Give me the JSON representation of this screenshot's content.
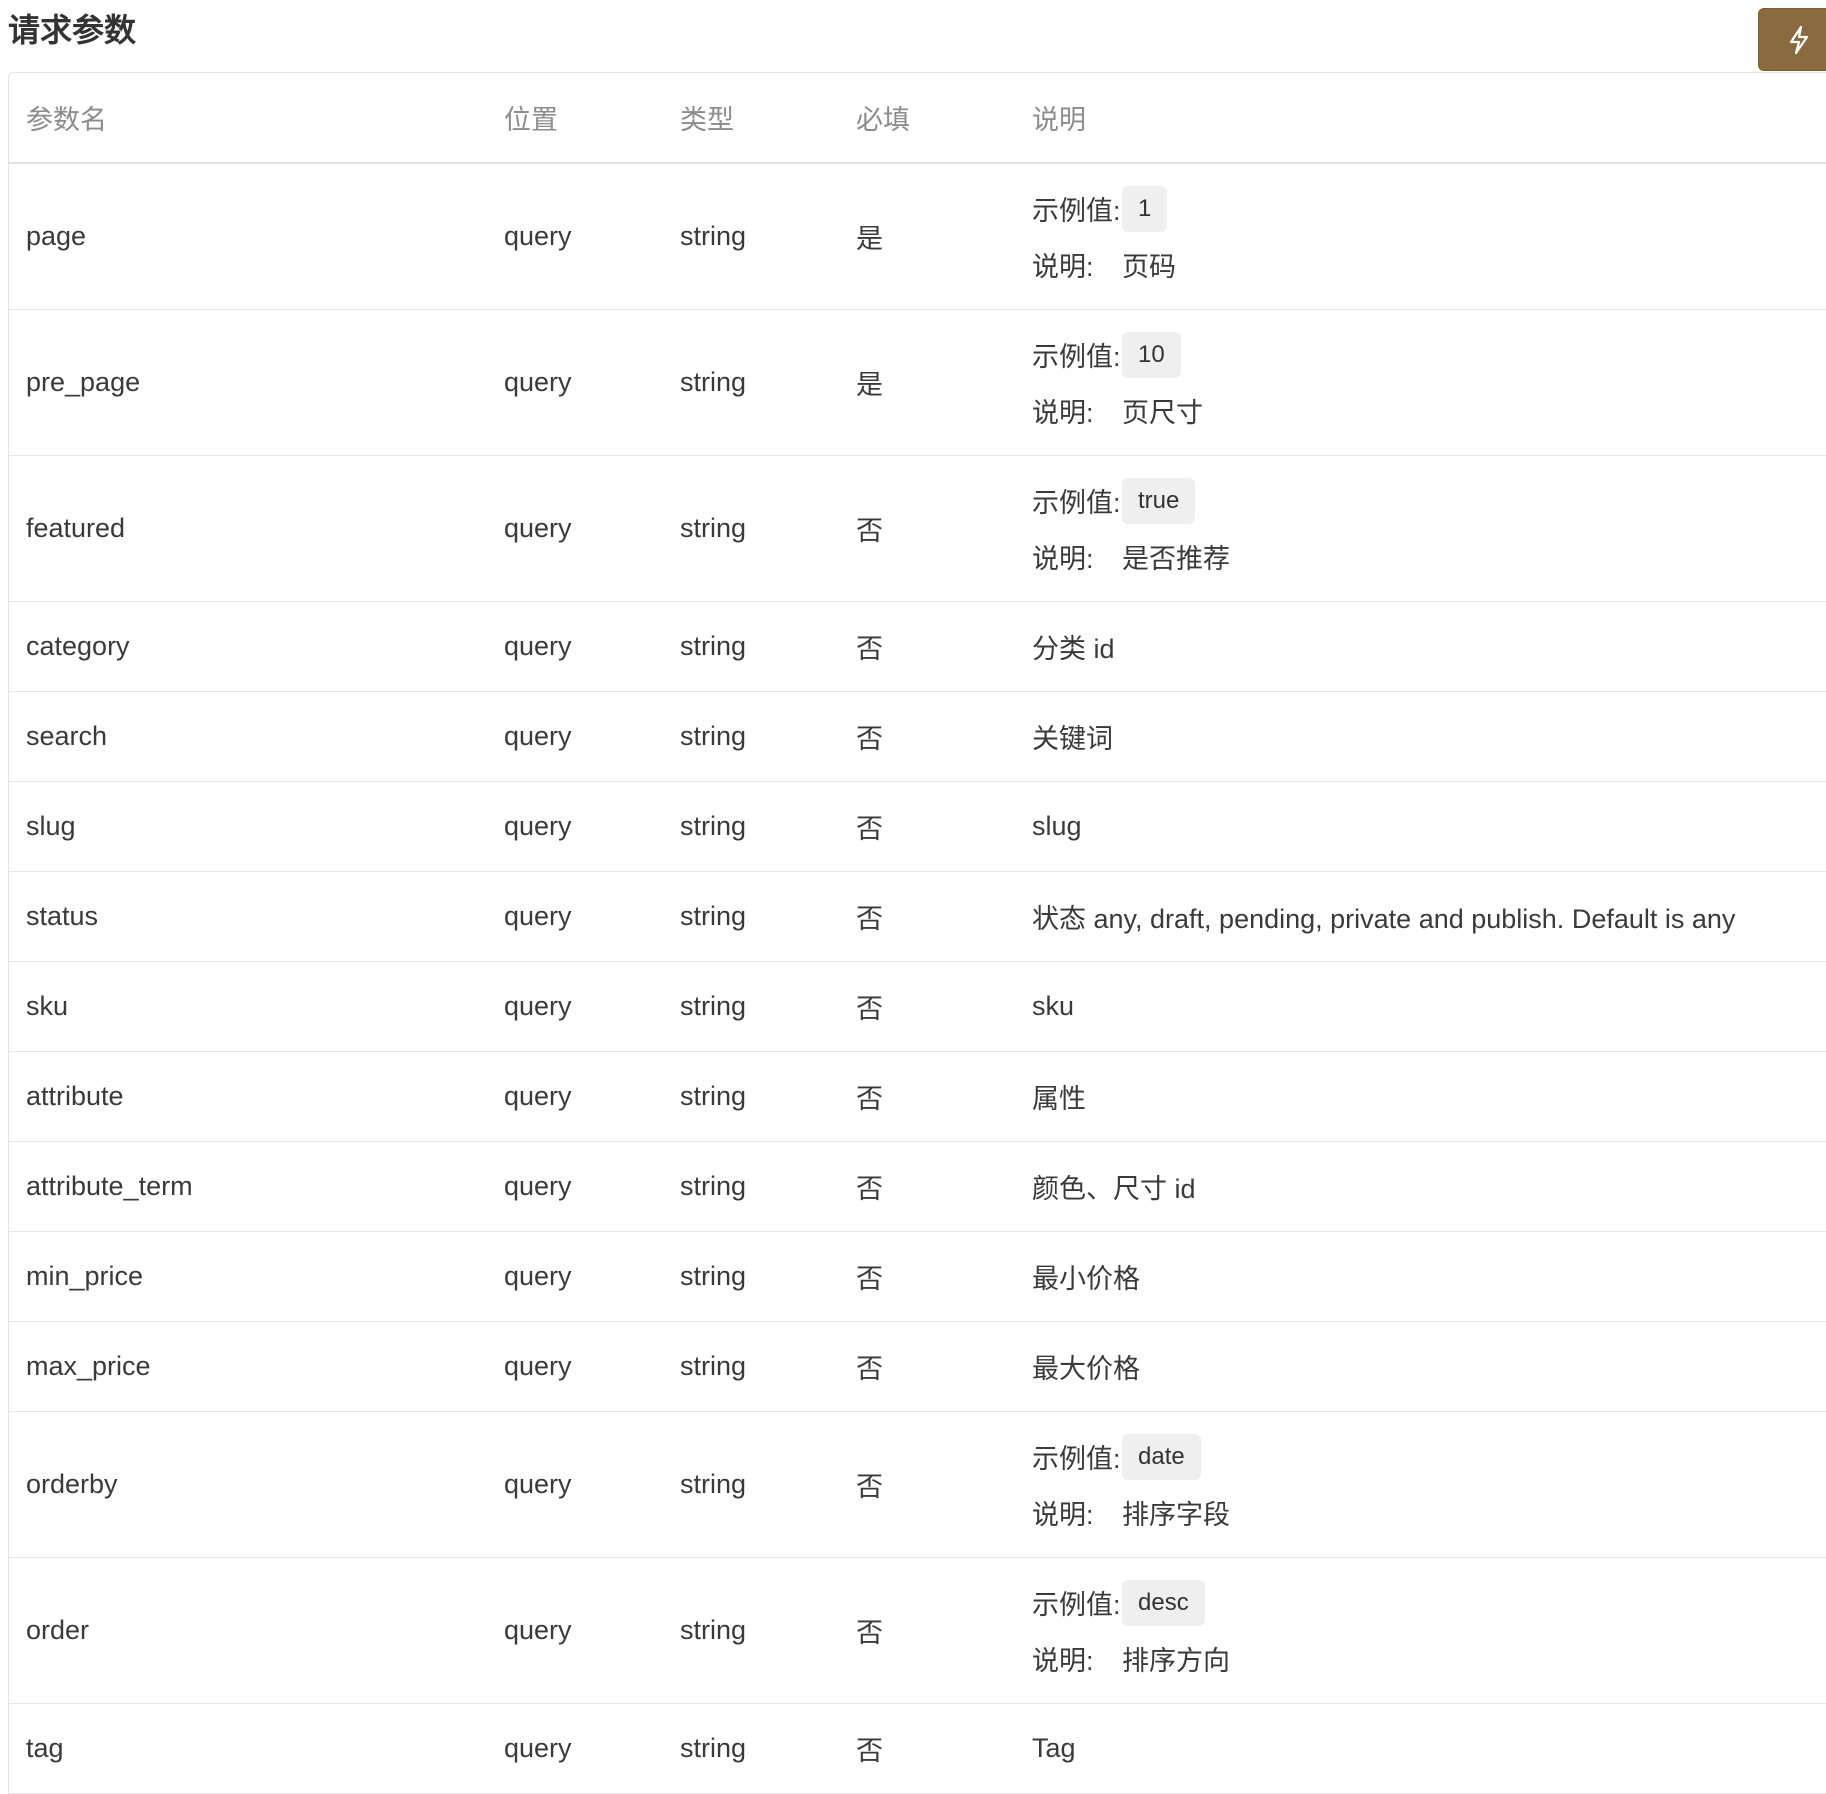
{
  "section": {
    "title": "请求参数"
  },
  "action_button": {
    "icon": "lightning-icon",
    "color": "#8a6a3f"
  },
  "table": {
    "headers": {
      "name": "参数名",
      "position": "位置",
      "type": "类型",
      "required": "必填",
      "description": "说明"
    },
    "example_label": "示例值:",
    "desc_label": "说明:",
    "rows": [
      {
        "name": "page",
        "position": "query",
        "type": "string",
        "required": "是",
        "example": "1",
        "description": "页码"
      },
      {
        "name": "pre_page",
        "position": "query",
        "type": "string",
        "required": "是",
        "example": "10",
        "description": "页尺寸"
      },
      {
        "name": "featured",
        "position": "query",
        "type": "string",
        "required": "否",
        "example": "true",
        "description": "是否推荐"
      },
      {
        "name": "category",
        "position": "query",
        "type": "string",
        "required": "否",
        "description": "分类 id"
      },
      {
        "name": "search",
        "position": "query",
        "type": "string",
        "required": "否",
        "description": "关键词"
      },
      {
        "name": "slug",
        "position": "query",
        "type": "string",
        "required": "否",
        "description": "slug"
      },
      {
        "name": "status",
        "position": "query",
        "type": "string",
        "required": "否",
        "description": "状态 any, draft, pending, private and publish. Default is any"
      },
      {
        "name": "sku",
        "position": "query",
        "type": "string",
        "required": "否",
        "description": "sku"
      },
      {
        "name": "attribute",
        "position": "query",
        "type": "string",
        "required": "否",
        "description": "属性"
      },
      {
        "name": "attribute_term",
        "position": "query",
        "type": "string",
        "required": "否",
        "description": "颜色、尺寸 id"
      },
      {
        "name": "min_price",
        "position": "query",
        "type": "string",
        "required": "否",
        "description": "最小价格"
      },
      {
        "name": "max_price",
        "position": "query",
        "type": "string",
        "required": "否",
        "description": "最大价格"
      },
      {
        "name": "orderby",
        "position": "query",
        "type": "string",
        "required": "否",
        "example": "date",
        "description": "排序字段"
      },
      {
        "name": "order",
        "position": "query",
        "type": "string",
        "required": "否",
        "example": "desc",
        "description": "排序方向"
      },
      {
        "name": "tag",
        "position": "query",
        "type": "string",
        "required": "否",
        "description": "Tag"
      }
    ]
  }
}
